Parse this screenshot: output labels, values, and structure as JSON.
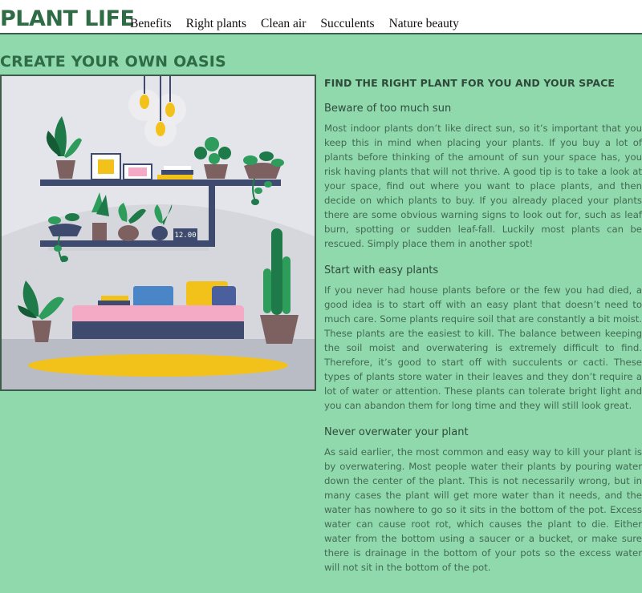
{
  "header": {
    "brand": "PLANT LIFE",
    "nav": [
      {
        "label": "Benefits"
      },
      {
        "label": "Right plants"
      },
      {
        "label": "Clean air"
      },
      {
        "label": "Succulents"
      },
      {
        "label": "Nature beauty"
      }
    ]
  },
  "page": {
    "title": "CREATE YOUR OWN OASIS",
    "illustration": {
      "clock_text": "12.00"
    }
  },
  "article": {
    "heading": "FIND THE RIGHT PLANT FOR YOU AND YOUR SPACE",
    "sections": [
      {
        "title": "Beware of too much sun",
        "body": "Most indoor plants don’t like direct sun, so it’s important that you keep this in mind when placing your plants. If you buy a lot of plants before thinking of the amount of sun your space has, you risk having plants that will not thrive. A good tip is to take a look at your space, find out where you want to place plants, and then decide on which plants to buy. If you already placed your plants there are some obvious warning signs to look out for, such as leaf burn, spotting or sudden leaf-fall. Luckily most plants can be rescued. Simply place them in another spot!"
      },
      {
        "title": "Start with easy plants",
        "body": "If you never had house plants before or the few you had died, a good idea is to start off with an easy plant that doesn’t need to much care. Some plants require soil that are constantly a bit moist. These plants are the easiest to kill. The balance between keeping the soil moist and overwatering is extremely difficult to find. Therefore, it’s good to start off with succulents or cacti. These types of plants store water in their leaves and they don’t require a lot of water or attention. These plants can tolerate bright light and you can abandon them for long time and they will still look great."
      },
      {
        "title": "Never overwater your plant",
        "body": "As said earlier, the most common and easy way to kill your plant is by overwatering. Most people water their plants by pouring water down the center of the plant. This is not necessarily wrong, but in many cases the plant will get more water than it needs, and the water has nowhere to go so it sits in the bottom of the pot. Excess water can cause root rot, which causes the plant to die. Either water from the bottom using a saucer or a bucket, or make sure there is drainage in the bottom of your pots so the excess water will not sit in the bottom of the pot."
      }
    ]
  },
  "colors": {
    "background": "#8fd9ad",
    "brand_green": "#2f6b45",
    "text": "#436a52"
  }
}
